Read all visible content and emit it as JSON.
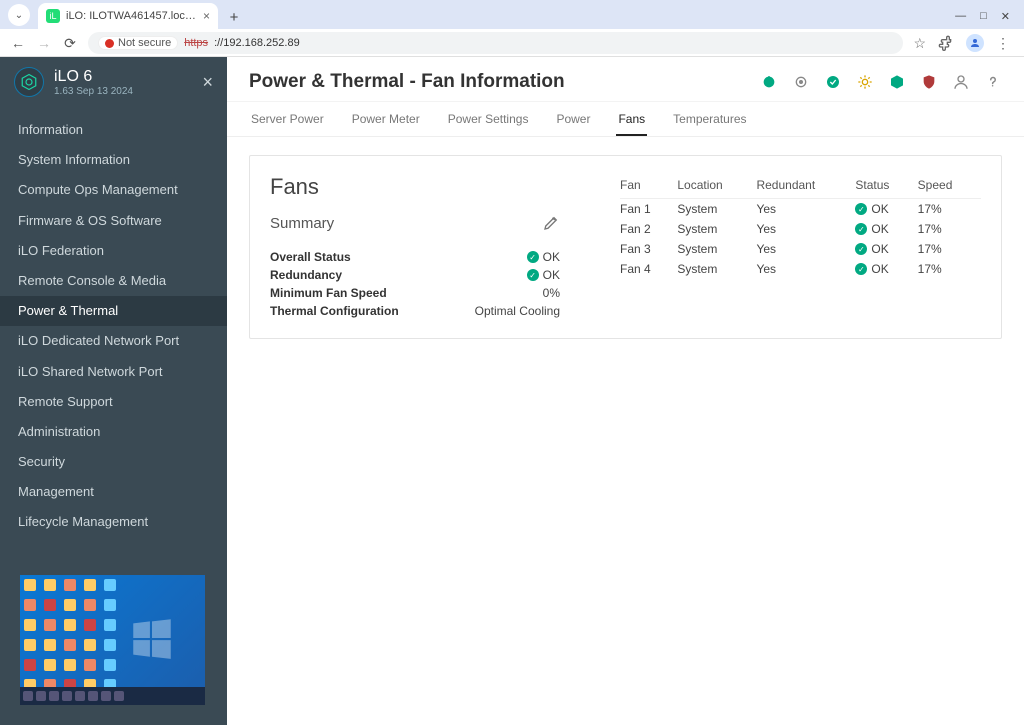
{
  "browser": {
    "tab_title": "iLO: ILOTWA461457.localdomai",
    "not_secure_label": "Not secure",
    "url_scheme": "https",
    "url_rest": "://192.168.252.89"
  },
  "sidebar": {
    "product": "iLO 6",
    "version": "1.63 Sep 13 2024",
    "items": [
      {
        "label": "Information"
      },
      {
        "label": "System Information"
      },
      {
        "label": "Compute Ops Management"
      },
      {
        "label": "Firmware & OS Software"
      },
      {
        "label": "iLO Federation"
      },
      {
        "label": "Remote Console & Media"
      },
      {
        "label": "Power & Thermal"
      },
      {
        "label": "iLO Dedicated Network Port"
      },
      {
        "label": "iLO Shared Network Port"
      },
      {
        "label": "Remote Support"
      },
      {
        "label": "Administration"
      },
      {
        "label": "Security"
      },
      {
        "label": "Management"
      },
      {
        "label": "Lifecycle Management"
      }
    ],
    "active_index": 6
  },
  "page": {
    "title": "Power & Thermal - Fan Information",
    "tabs": [
      {
        "label": "Server Power"
      },
      {
        "label": "Power Meter"
      },
      {
        "label": "Power Settings"
      },
      {
        "label": "Power"
      },
      {
        "label": "Fans"
      },
      {
        "label": "Temperatures"
      }
    ],
    "active_tab_index": 4
  },
  "fans_panel": {
    "heading": "Fans",
    "summary_label": "Summary",
    "rows": [
      {
        "k": "Overall Status",
        "v": "OK",
        "ok": true
      },
      {
        "k": "Redundancy",
        "v": "OK",
        "ok": true
      },
      {
        "k": "Minimum Fan Speed",
        "v": "0%",
        "ok": false
      },
      {
        "k": "Thermal Configuration",
        "v": "Optimal Cooling",
        "ok": false
      }
    ],
    "table": {
      "headers": [
        "Fan",
        "Location",
        "Redundant",
        "Status",
        "Speed"
      ],
      "rows": [
        {
          "fan": "Fan 1",
          "location": "System",
          "redundant": "Yes",
          "status": "OK",
          "speed": "17%"
        },
        {
          "fan": "Fan 2",
          "location": "System",
          "redundant": "Yes",
          "status": "OK",
          "speed": "17%"
        },
        {
          "fan": "Fan 3",
          "location": "System",
          "redundant": "Yes",
          "status": "OK",
          "speed": "17%"
        },
        {
          "fan": "Fan 4",
          "location": "System",
          "redundant": "Yes",
          "status": "OK",
          "speed": "17%"
        }
      ]
    }
  }
}
